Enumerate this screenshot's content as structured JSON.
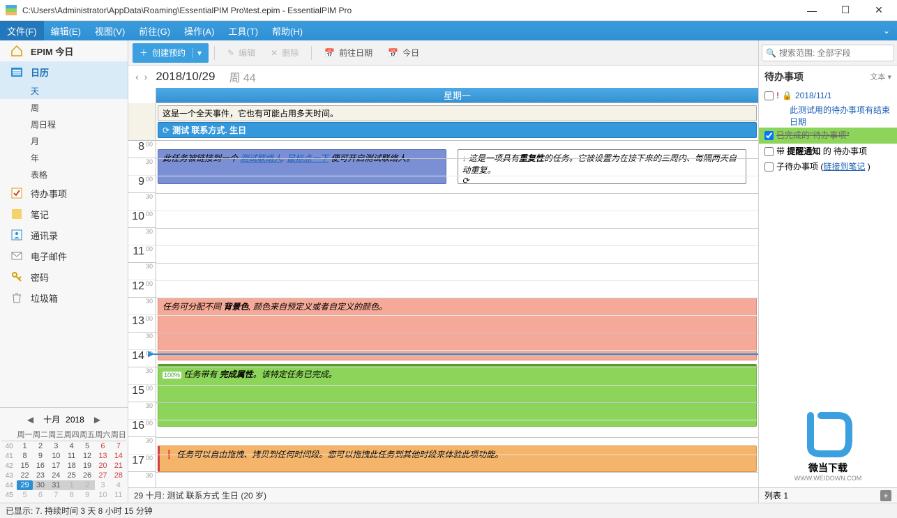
{
  "window": {
    "title": "C:\\Users\\Administrator\\AppData\\Roaming\\EssentialPIM Pro\\test.epim - EssentialPIM Pro"
  },
  "menu": {
    "file": "文件(F)",
    "edit": "编辑(E)",
    "view": "视图(V)",
    "goto": "前往(G)",
    "action": "操作(A)",
    "tools": "工具(T)",
    "help": "帮助(H)"
  },
  "sidebar": {
    "today": "EPIM 今日",
    "calendar": "日历",
    "sub": {
      "day": "天",
      "week": "周",
      "schedule": "周日程",
      "month": "月",
      "year": "年",
      "table": "表格"
    },
    "todo": "待办事项",
    "notes": "笔记",
    "contacts": "通讯录",
    "mail": "电子邮件",
    "password": "密码",
    "trash": "垃圾箱"
  },
  "minical": {
    "month": "十月",
    "year": "2018",
    "dow": [
      "周一",
      "周二",
      "周三",
      "周四",
      "周五",
      "周六",
      "周日"
    ],
    "weeks": [
      {
        "wk": "40",
        "d": [
          "1",
          "2",
          "3",
          "4",
          "5",
          "6",
          "7"
        ]
      },
      {
        "wk": "41",
        "d": [
          "8",
          "9",
          "10",
          "11",
          "12",
          "13",
          "14"
        ]
      },
      {
        "wk": "42",
        "d": [
          "15",
          "16",
          "17",
          "18",
          "19",
          "20",
          "21"
        ]
      },
      {
        "wk": "43",
        "d": [
          "22",
          "23",
          "24",
          "25",
          "26",
          "27",
          "28"
        ]
      },
      {
        "wk": "44",
        "d": [
          "29",
          "30",
          "31",
          "1",
          "2",
          "3",
          "4"
        ]
      },
      {
        "wk": "45",
        "d": [
          "5",
          "6",
          "7",
          "8",
          "9",
          "10",
          "11"
        ]
      }
    ]
  },
  "toolbar": {
    "create": "创建预约",
    "edit": "编辑",
    "delete": "删除",
    "gotoDate": "前往日期",
    "today": "今日"
  },
  "datenav": {
    "date": "2018/10/29",
    "week": "周 44"
  },
  "schedule": {
    "dayHeader": "星期一",
    "allday1": "这是一个全天事件，它也有可能占用多天时间。",
    "birthday": "测试 联系方式. 生日",
    "ev_blue_pre": "此任务被链接到一个 ",
    "ev_blue_link1": "测试联络人",
    "ev_blue_mid": ". ",
    "ev_blue_link2": "鼠标点一下",
    "ev_blue_post": " 便可开启测试联络人。",
    "ev_recur_pre": "这是一项具有",
    "ev_recur_bold": "重复性",
    "ev_recur_post": "的任务。它被设置为在接下来的三周内、每隔两天自动重复。",
    "ev_red_pre": "任务可分配不同 ",
    "ev_red_bold": "背景色",
    "ev_red_post": ", 颜色来自预定义或者自定义的颜色。",
    "ev_green_pre": "任务带有 ",
    "ev_green_bold": "完成属性",
    "ev_green_post": "。该特定任务已完成。",
    "ev_orange": "任务可以自由拖拽、拷贝到任何时间段。您可以拖拽此任务到其他时段来体验此项功能。",
    "green_badge": "100%"
  },
  "footer": {
    "info": "29 十月:  测试 联系方式 生日  (20 岁)"
  },
  "right": {
    "search_placeholder": "搜索范围: 全部字段",
    "title": "待办事项",
    "mode": "文本 ▾",
    "item1_date": "2018/11/1",
    "item1_desc": "此测试用的待办事项有结束日期",
    "item2": "已完成的\"待办事项\"",
    "item3_pre": "带 ",
    "item3_bold": "提醒通知",
    "item3_post": " 的 待办事项",
    "item4_pre": "子待办事项 (",
    "item4_link": "链接到笔记",
    "item4_post": " )",
    "list_label": "列表 1"
  },
  "status": {
    "text": "已显示: 7. 持续时间 3 天 8 小时 15 分钟"
  },
  "watermark": {
    "t1": "微当下载",
    "t2": "WWW.WEIDOWN.COM"
  }
}
